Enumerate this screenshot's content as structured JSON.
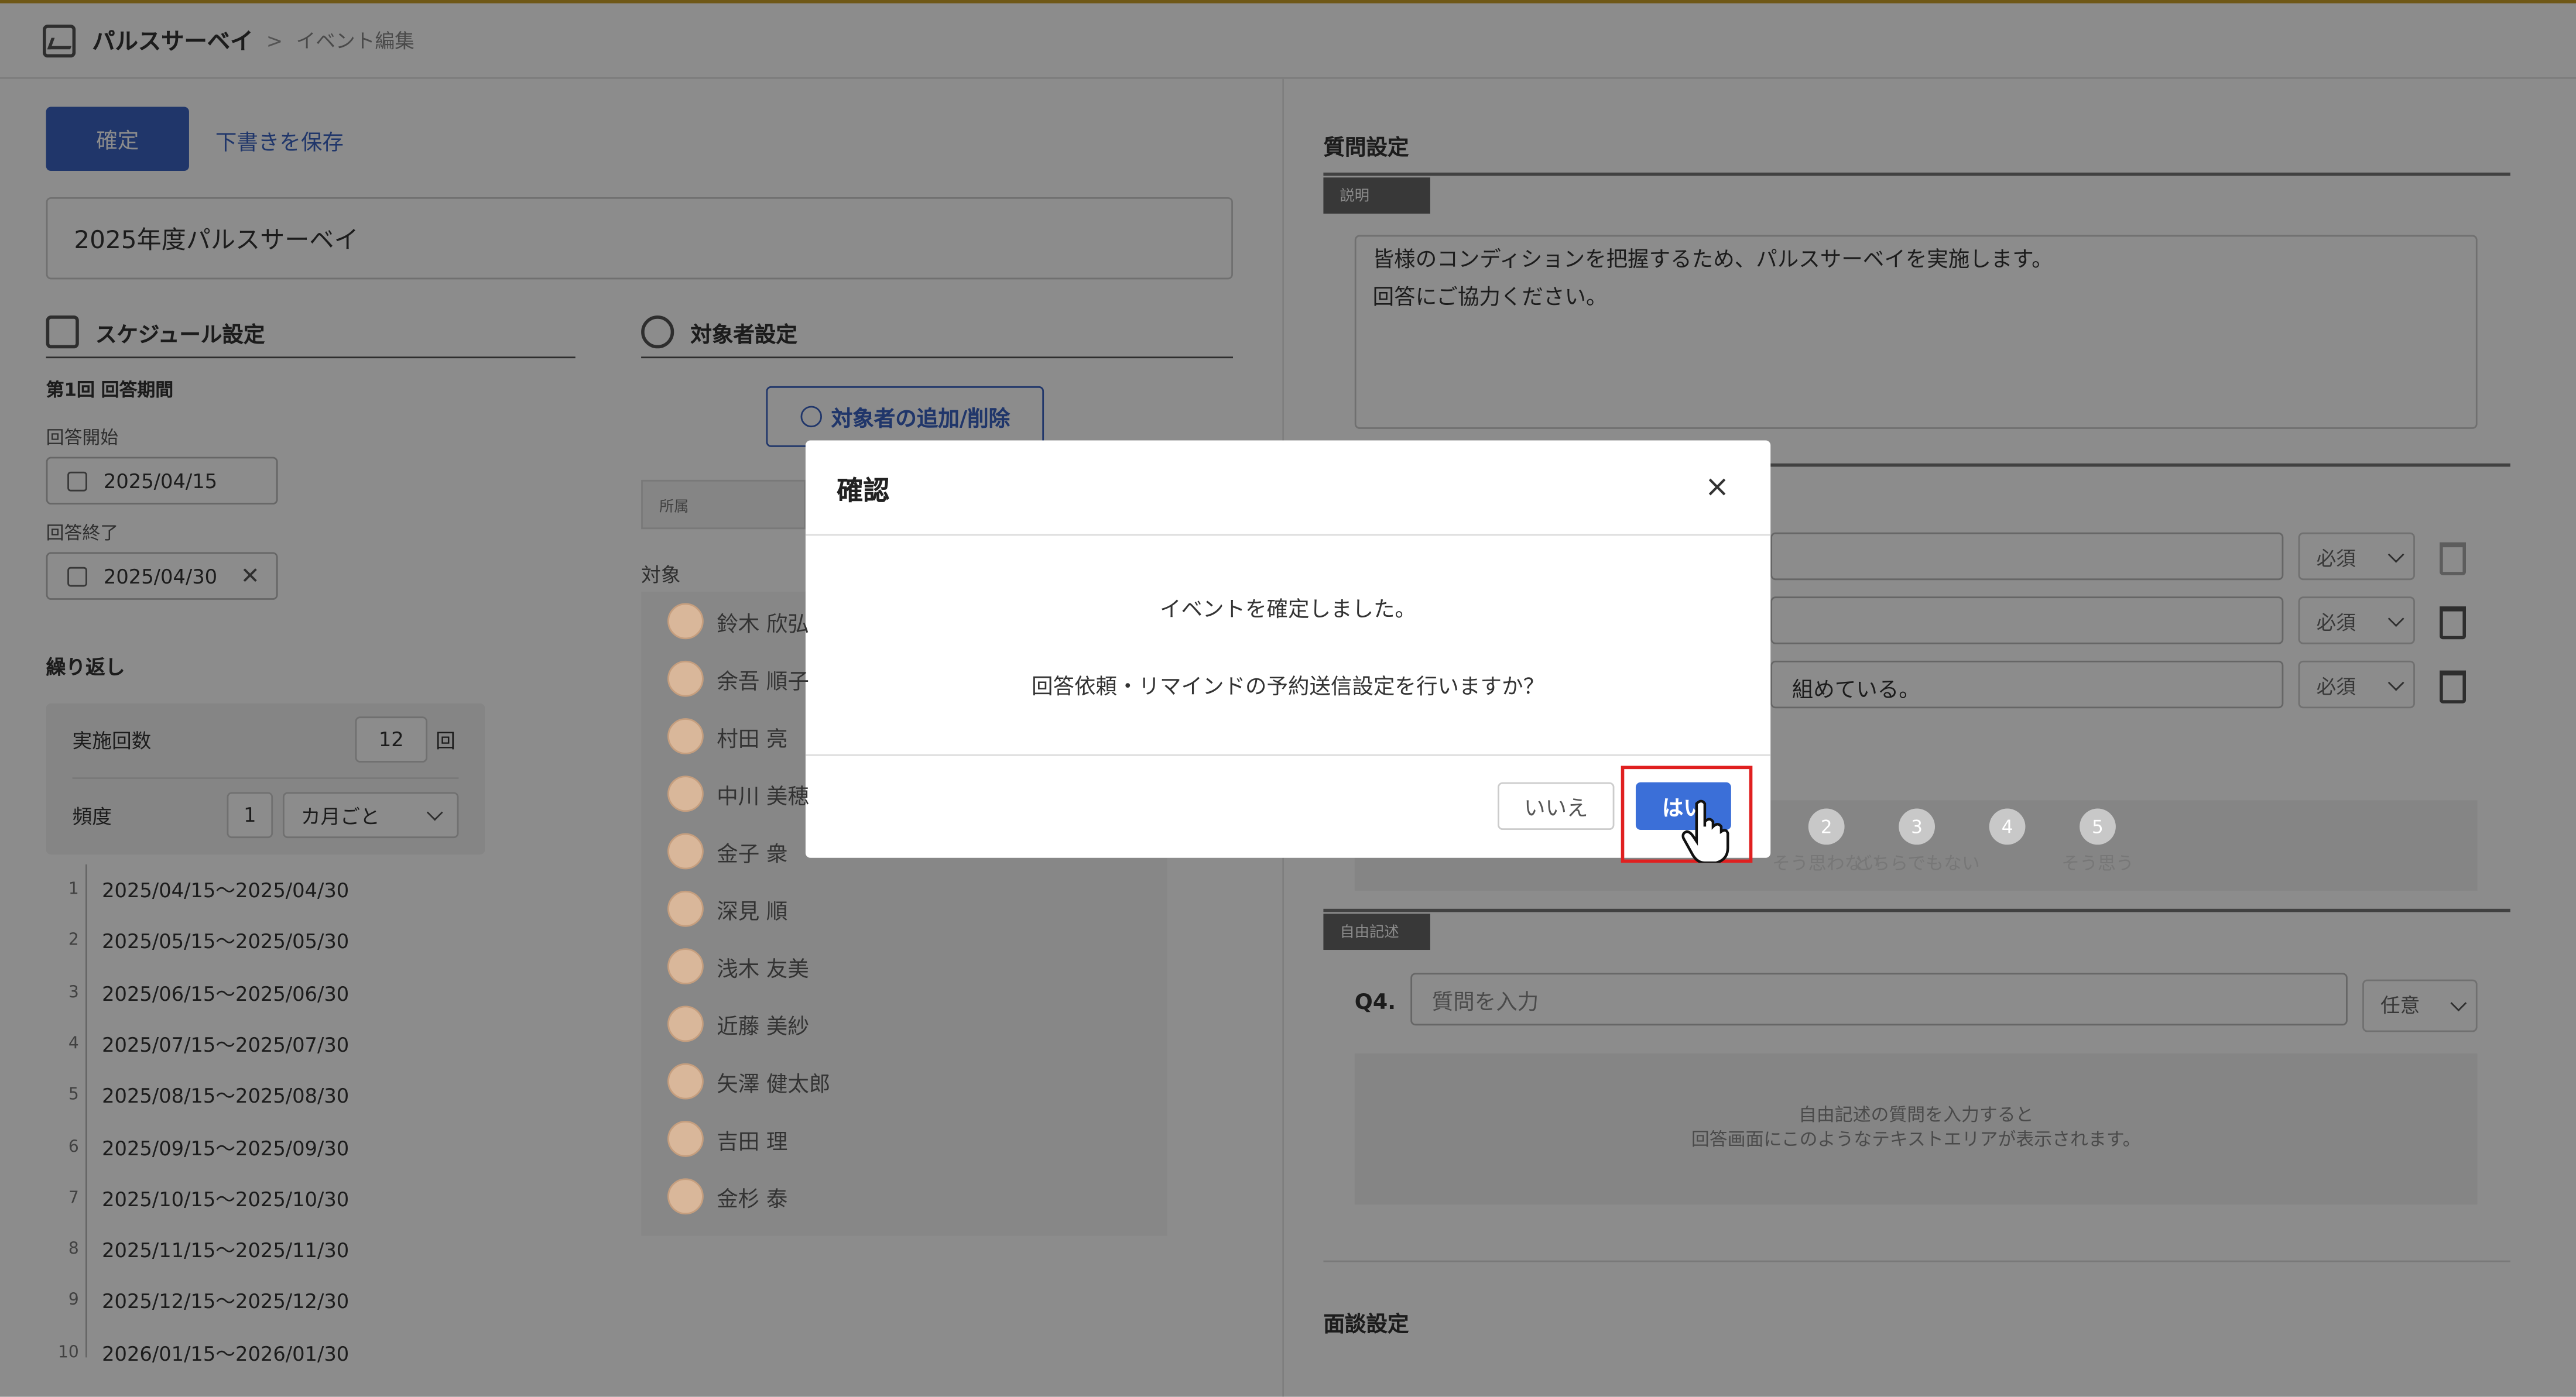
{
  "header": {
    "app_name": "パルスサーベイ",
    "separator": ">",
    "breadcrumb": "イベント編集"
  },
  "toolbar": {
    "confirm_label": "確定",
    "save_draft_label": "下書きを保存"
  },
  "event": {
    "title": "2025年度パルスサーベイ"
  },
  "schedule": {
    "section_title": "スケジュール設定",
    "period_heading": "第1回 回答期間",
    "start_label": "回答開始",
    "start_date": "2025/04/15",
    "end_label": "回答終了",
    "end_date": "2025/04/30",
    "repeat_heading": "繰り返し",
    "count_label": "実施回数",
    "count_value": "12",
    "count_unit": "回",
    "frequency_label": "頻度",
    "frequency_value": "1",
    "frequency_unit": "カ月ごと",
    "periods": [
      {
        "n": "1",
        "range": "2025/04/15～2025/04/30"
      },
      {
        "n": "2",
        "range": "2025/05/15～2025/05/30"
      },
      {
        "n": "3",
        "range": "2025/06/15～2025/06/30"
      },
      {
        "n": "4",
        "range": "2025/07/15～2025/07/30"
      },
      {
        "n": "5",
        "range": "2025/08/15～2025/08/30"
      },
      {
        "n": "6",
        "range": "2025/09/15～2025/09/30"
      },
      {
        "n": "7",
        "range": "2025/10/15～2025/10/30"
      },
      {
        "n": "8",
        "range": "2025/11/15～2025/11/30"
      },
      {
        "n": "9",
        "range": "2025/12/15～2025/12/30"
      },
      {
        "n": "10",
        "range": "2026/01/15～2026/01/30"
      }
    ]
  },
  "targets": {
    "section_title": "対象者設定",
    "add_remove_label": "対象者の追加/削除",
    "filter_label": "所属",
    "list_label": "対象",
    "people": [
      "鈴木 欣弘",
      "余吾 順子",
      "村田 亮",
      "中川 美穂",
      "金子 衆",
      "深見 順",
      "浅木 友美",
      "近藤 美紗",
      "矢澤 健太郎",
      "吉田 理",
      "金杉 泰"
    ]
  },
  "questions": {
    "section_title": "質問設定",
    "description_tag": "説明",
    "description_text": "皆様のコンディションを把握するため、パルスサーベイを実施します。\n回答にご協力ください。",
    "q3_partial_text": "組めている。",
    "required_label": "必須",
    "scale": [
      {
        "n": "2",
        "label": "そう思わない"
      },
      {
        "n": "3",
        "label": "どちらでもない"
      },
      {
        "n": "4",
        "label": ""
      },
      {
        "n": "5",
        "label": "そう思う"
      }
    ],
    "free_tag": "自由記述",
    "q4_label": "Q4.",
    "q4_placeholder": "質問を入力",
    "optional_label": "任意",
    "free_hint": "自由記述の質問を入力すると\n回答画面にこのようなテキストエリアが表示されます。",
    "interview_title": "面談設定"
  },
  "dialog": {
    "title": "確認",
    "close_symbol": "×",
    "message1": "イベントを確定しました。",
    "message2": "回答依頼・リマインドの予約送信設定を行いますか？",
    "no_label": "いいえ",
    "yes_label": "はい"
  },
  "colors": {
    "primary": "#3b63c2",
    "highlight": "#e02020",
    "top_accent": "#caa12a"
  }
}
